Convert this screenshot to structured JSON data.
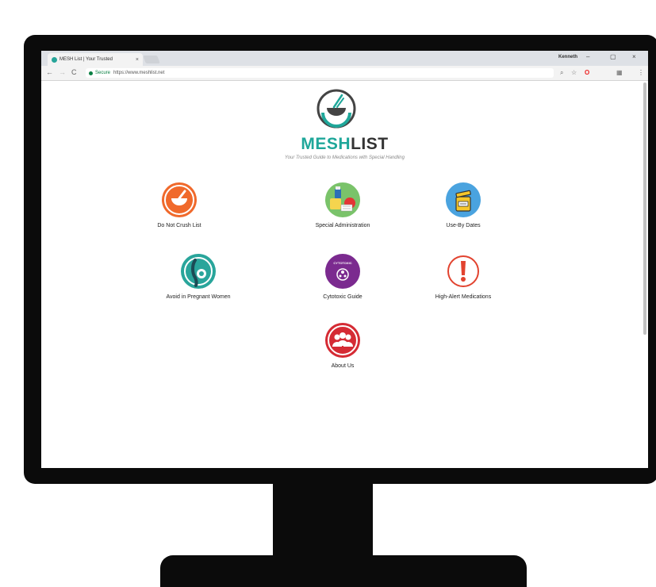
{
  "browser": {
    "tab_title": "MESH List | Your Trusted",
    "tab_close": "×",
    "user_name": "Kenneth",
    "window_controls": {
      "minimize": "–",
      "maximize": "▢",
      "close": "×"
    },
    "nav": {
      "back": "←",
      "forward": "→",
      "reload": "C"
    },
    "secure_label": "Secure",
    "url": "https://www.meshlist.net",
    "toolbar_icons": {
      "zoom": "⌕",
      "star": "☆",
      "opera": "O",
      "extensions": "▦",
      "menu": "⋮"
    }
  },
  "site": {
    "brand_part1": "MESH",
    "brand_part2": "LIST",
    "tagline": "Your Trusted Guide to Medications with Special Handling",
    "tiles": [
      {
        "label": "Do Not Crush List",
        "icon": "mortar-pestle-icon",
        "color": "#f0692b"
      },
      {
        "label": "Special Administration",
        "icon": "medicine-supplies-icon",
        "color": "#7ac36a"
      },
      {
        "label": "Use-By Dates",
        "icon": "medicine-jar-icon",
        "color": "#4aa3df"
      },
      {
        "label": "Avoid in Pregnant Women",
        "icon": "pregnant-woman-icon",
        "color": "#29a59b"
      },
      {
        "label": "Cytotoxic Guide",
        "icon": "cytotoxic-icon",
        "color": "#7b2a8f",
        "badge": "CYTOTOXIC"
      },
      {
        "label": "High-Alert Medications",
        "icon": "exclamation-icon",
        "color": "#e2432f"
      },
      {
        "label": "About Us",
        "icon": "group-icon",
        "color": "#d52b34"
      }
    ]
  },
  "colors": {
    "accent": "#1fa79a",
    "dark": "#333333",
    "monitor": "#0b0b0b"
  }
}
